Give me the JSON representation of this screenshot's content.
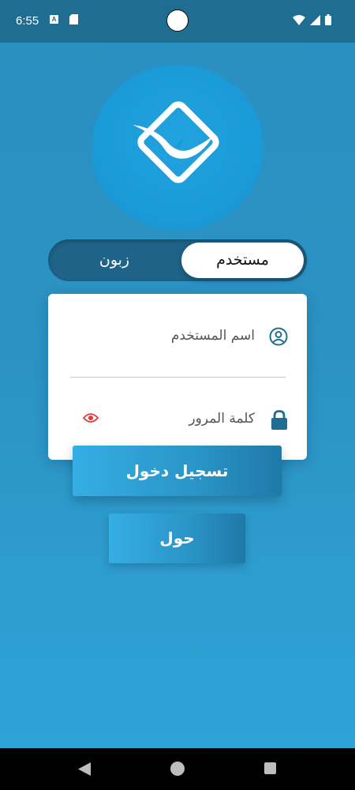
{
  "status_bar": {
    "time": "6:55",
    "notification_letter": "A"
  },
  "toggle": {
    "active_label": "مستخدم",
    "inactive_label": "زبون"
  },
  "form": {
    "username_placeholder": "اسم المستخدم",
    "password_placeholder": "كلمة المرور"
  },
  "buttons": {
    "login_label": "تسجيل دخول",
    "about_label": "حول"
  },
  "colors": {
    "accent": "#1f6e92",
    "field_icon": "#1f6e92",
    "eye_icon": "#e53935"
  }
}
